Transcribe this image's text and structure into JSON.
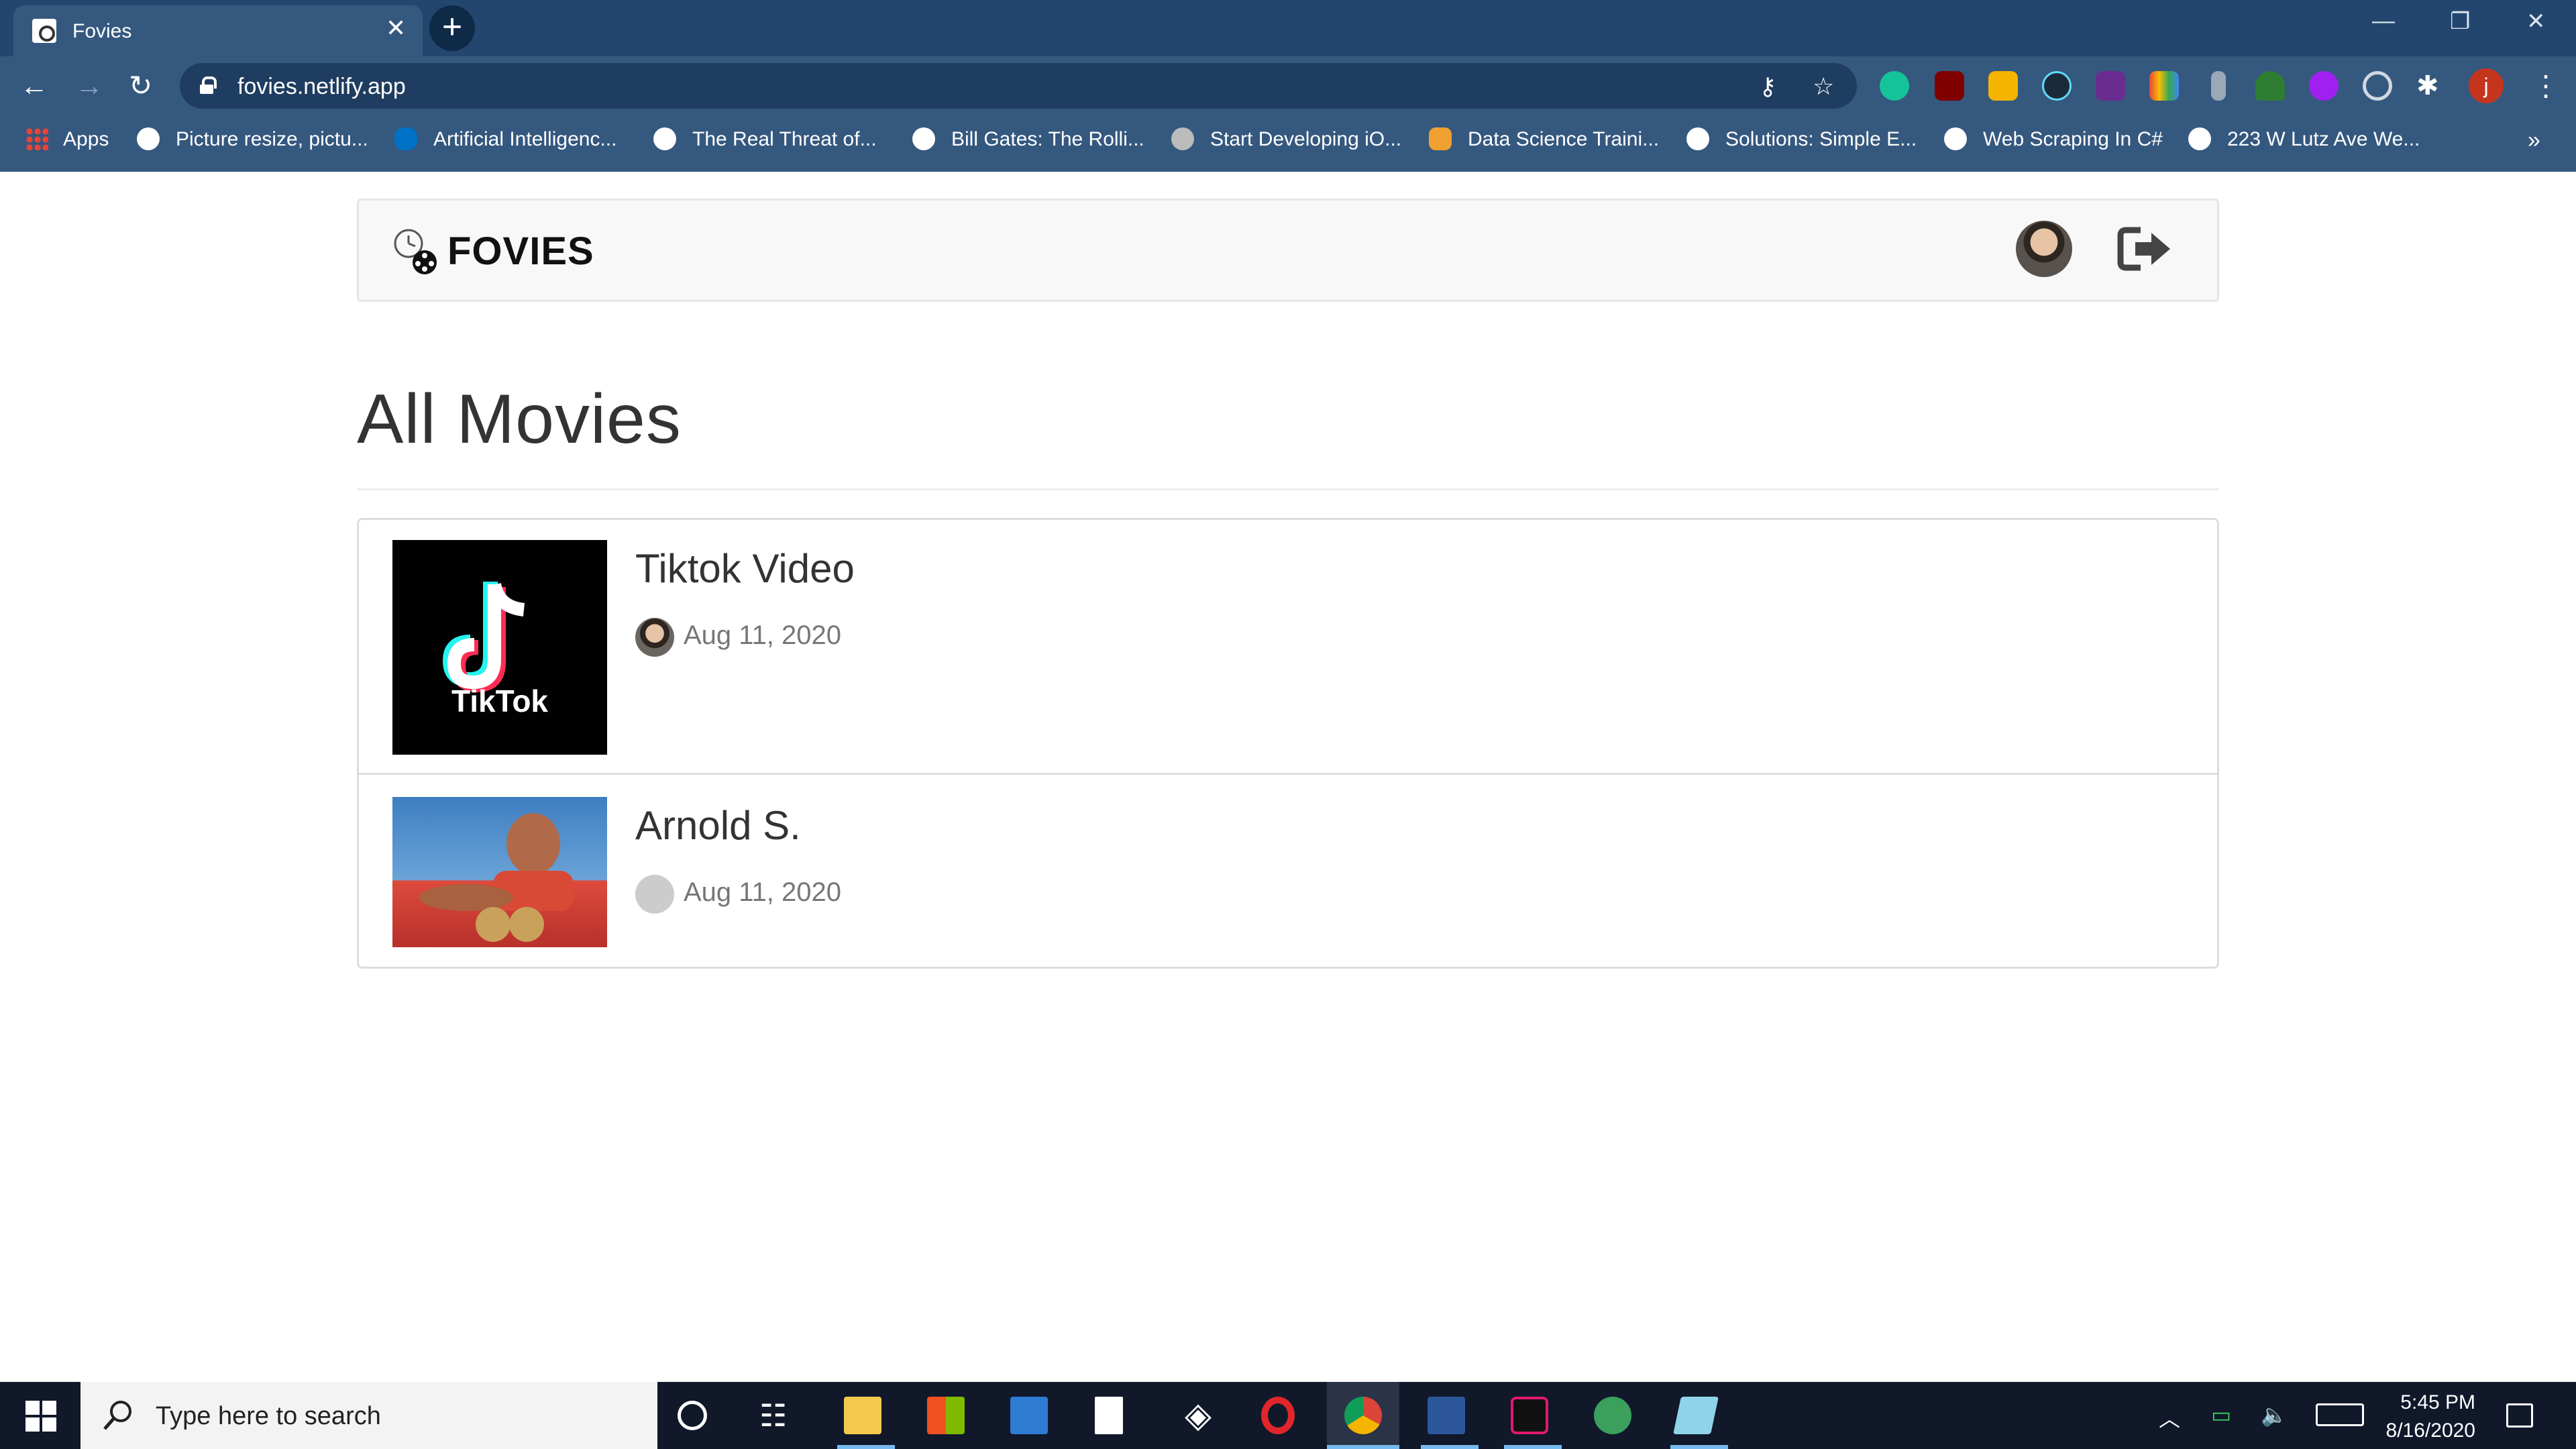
{
  "browser": {
    "tab_title": "Fovies",
    "url": "fovies.netlify.app",
    "profile_initial": "j",
    "bookmarks": [
      {
        "label": "Apps",
        "icon": "apps-grid-icon"
      },
      {
        "label": "Picture resize, pictu...",
        "icon": "globe-icon"
      },
      {
        "label": "Artificial Intelligenc...",
        "icon": "intel-icon"
      },
      {
        "label": "The Real Threat of...",
        "icon": "globe-icon"
      },
      {
        "label": "Bill Gates: The Rolli...",
        "icon": "globe-icon"
      },
      {
        "label": "Start Developing iO...",
        "icon": "apple-icon"
      },
      {
        "label": "Data Science Traini...",
        "icon": "person-icon"
      },
      {
        "label": "Solutions: Simple E...",
        "icon": "globe-icon"
      },
      {
        "label": "Web Scraping In C#",
        "icon": "globe-icon"
      },
      {
        "label": "223 W Lutz Ave We...",
        "icon": "globe-icon"
      }
    ],
    "overflow": "»"
  },
  "app": {
    "brand": "FOVIES",
    "page_title": "All Movies",
    "movies": [
      {
        "title": "Tiktok Video",
        "date": "Aug 11, 2020",
        "thumb_text": "TikTok"
      },
      {
        "title": "Arnold S.",
        "date": "Aug 11, 2020"
      }
    ]
  },
  "taskbar": {
    "search_placeholder": "Type here to search",
    "time": "5:45 PM",
    "date": "8/16/2020"
  },
  "colors": {
    "tabstrip": "#22466e",
    "toolbar": "#35587f",
    "taskbar": "#10182a",
    "accent": "#76b9ed"
  }
}
